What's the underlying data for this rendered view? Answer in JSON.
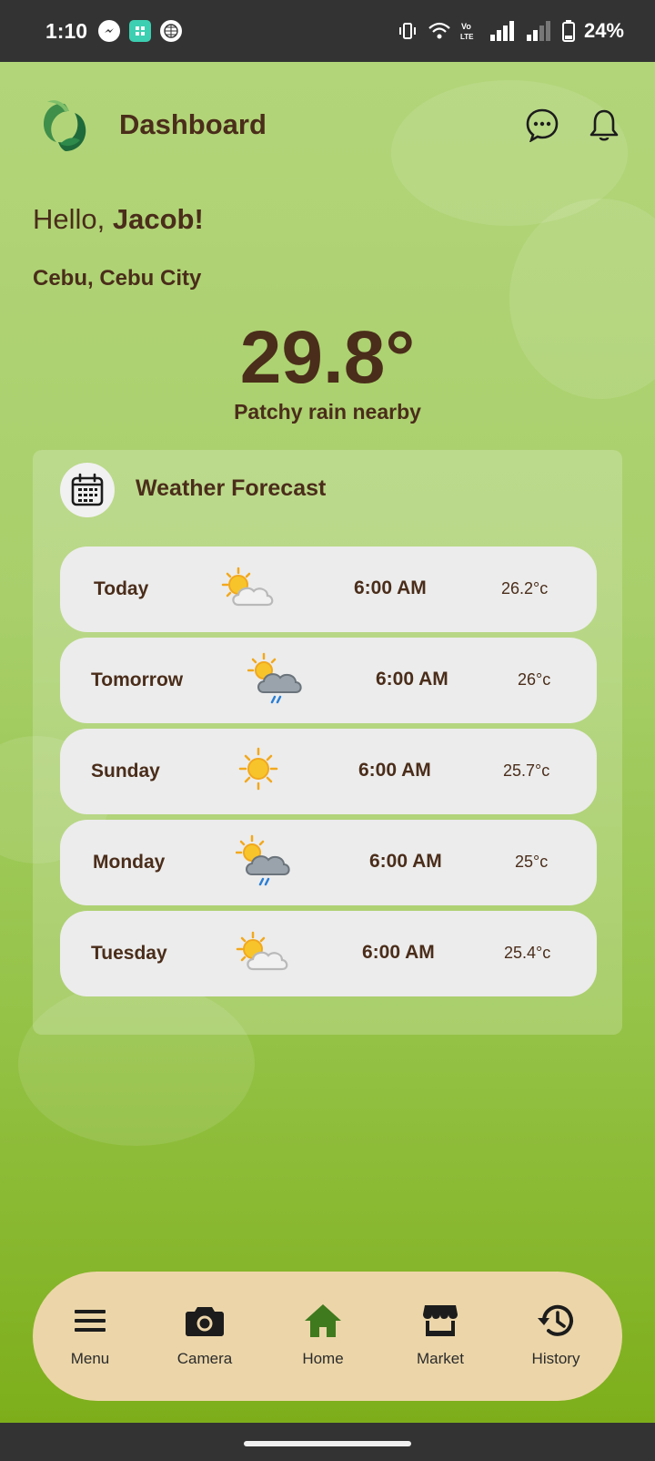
{
  "status_bar": {
    "time": "1:10",
    "battery": "24%"
  },
  "header": {
    "title": "Dashboard",
    "icons": [
      "logo-icon",
      "chat-icon",
      "bell-icon"
    ]
  },
  "greeting": {
    "prefix": "Hello, ",
    "name": "Jacob!"
  },
  "location": "Cebu, Cebu City",
  "current": {
    "temperature": "29.8°",
    "condition": "Patchy rain nearby"
  },
  "forecast": {
    "title": "Weather Forecast",
    "rows": [
      {
        "day": "Today",
        "icon": "partly-cloudy-icon",
        "time": "6:00 AM",
        "temp": "26.2°c"
      },
      {
        "day": "Tomorrow",
        "icon": "rain-cloud-sun-icon",
        "time": "6:00 AM",
        "temp": "26°c"
      },
      {
        "day": "Sunday",
        "icon": "sunny-icon",
        "time": "6:00 AM",
        "temp": "25.7°c"
      },
      {
        "day": "Monday",
        "icon": "rain-cloud-sun-icon",
        "time": "6:00 AM",
        "temp": "25°c"
      },
      {
        "day": "Tuesday",
        "icon": "partly-cloudy-icon",
        "time": "6:00 AM",
        "temp": "25.4°c"
      }
    ]
  },
  "nav": {
    "items": [
      {
        "label": "Menu",
        "icon": "menu-icon"
      },
      {
        "label": "Camera",
        "icon": "camera-icon"
      },
      {
        "label": "Home",
        "icon": "home-icon",
        "active": true
      },
      {
        "label": "Market",
        "icon": "store-icon"
      },
      {
        "label": "History",
        "icon": "history-icon"
      }
    ]
  },
  "colors": {
    "brand_text": "#4a2d1a",
    "nav_bg": "#ecd6a9",
    "active_nav": "#3f7a1e"
  }
}
